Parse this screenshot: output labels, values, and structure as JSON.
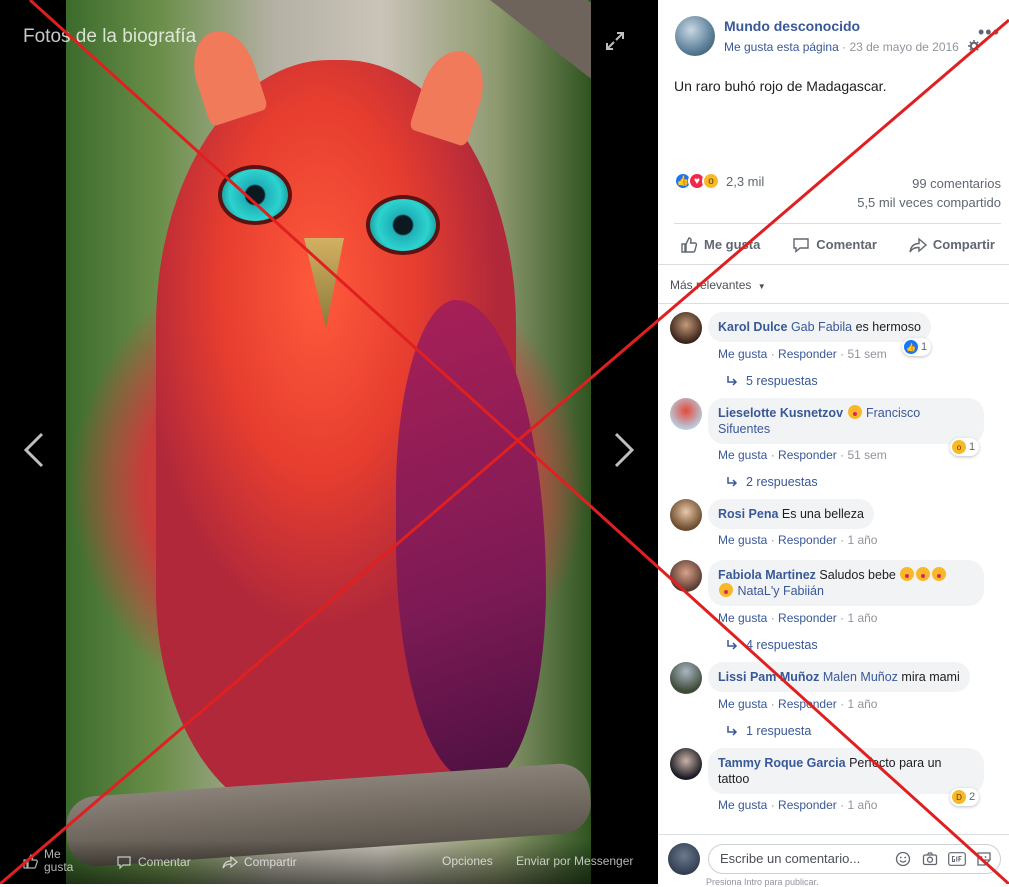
{
  "viewer": {
    "title": "Fotos de la biografía",
    "bottom_bar": {
      "like_line1": "Me",
      "like_line2": "gusta",
      "comment": "Comentar",
      "share": "Compartir",
      "options": "Opciones",
      "messenger": "Enviar por Messenger"
    }
  },
  "post": {
    "page_name": "Mundo desconocido",
    "like_page": "Me gusta esta página",
    "dot": "·",
    "date": "23 de mayo de 2016",
    "text": "Un raro buhó rojo de Madagascar.",
    "reaction_count": "2,3 mil",
    "comments_count": "99 comentarios",
    "shares_count": "5,5 mil veces compartido",
    "actions": {
      "like": "Me gusta",
      "comment": "Comentar",
      "share": "Compartir"
    },
    "filter": "Más relevantes"
  },
  "comments": [
    {
      "name": "Karol Dulce",
      "tag": "Gab Fabila",
      "text": " es hermoso",
      "like": "Me gusta",
      "reply": "Responder",
      "age": "51 sem",
      "reaction_count": "1",
      "replies": "5 respuestas"
    },
    {
      "name": "Lieselotte Kusnetzov",
      "tag_line1": "Francisco",
      "tag_line2": "Sifuentes",
      "like": "Me gusta",
      "reply": "Responder",
      "age": "51 sem",
      "reaction_count": "1",
      "replies": "2 respuestas"
    },
    {
      "name": "Rosi Pena",
      "text": " Es una belleza",
      "like": "Me gusta",
      "reply": "Responder",
      "age": "1 año"
    },
    {
      "name": "Fabiola Martinez",
      "text": " Saludos bebe",
      "tag": "NataL'y Fabiián",
      "like": "Me gusta",
      "reply": "Responder",
      "age": "1 año",
      "replies": "4 respuestas"
    },
    {
      "name": "Lissi Pam Muñoz",
      "tag": "Malen Muñoz",
      "text": " mira mami",
      "like": "Me gusta",
      "reply": "Responder",
      "age": "1 año",
      "replies": "1 respuesta"
    },
    {
      "name": "Tammy Roque Garcia",
      "text_line1": " Perfecto para un",
      "text_line2": "tattoo",
      "like": "Me gusta",
      "reply": "Responder",
      "age": "1 año",
      "reaction_count": "2"
    }
  ],
  "composer": {
    "placeholder": "Escribe un comentario...",
    "hint": "Presiona Intro para publicar."
  }
}
